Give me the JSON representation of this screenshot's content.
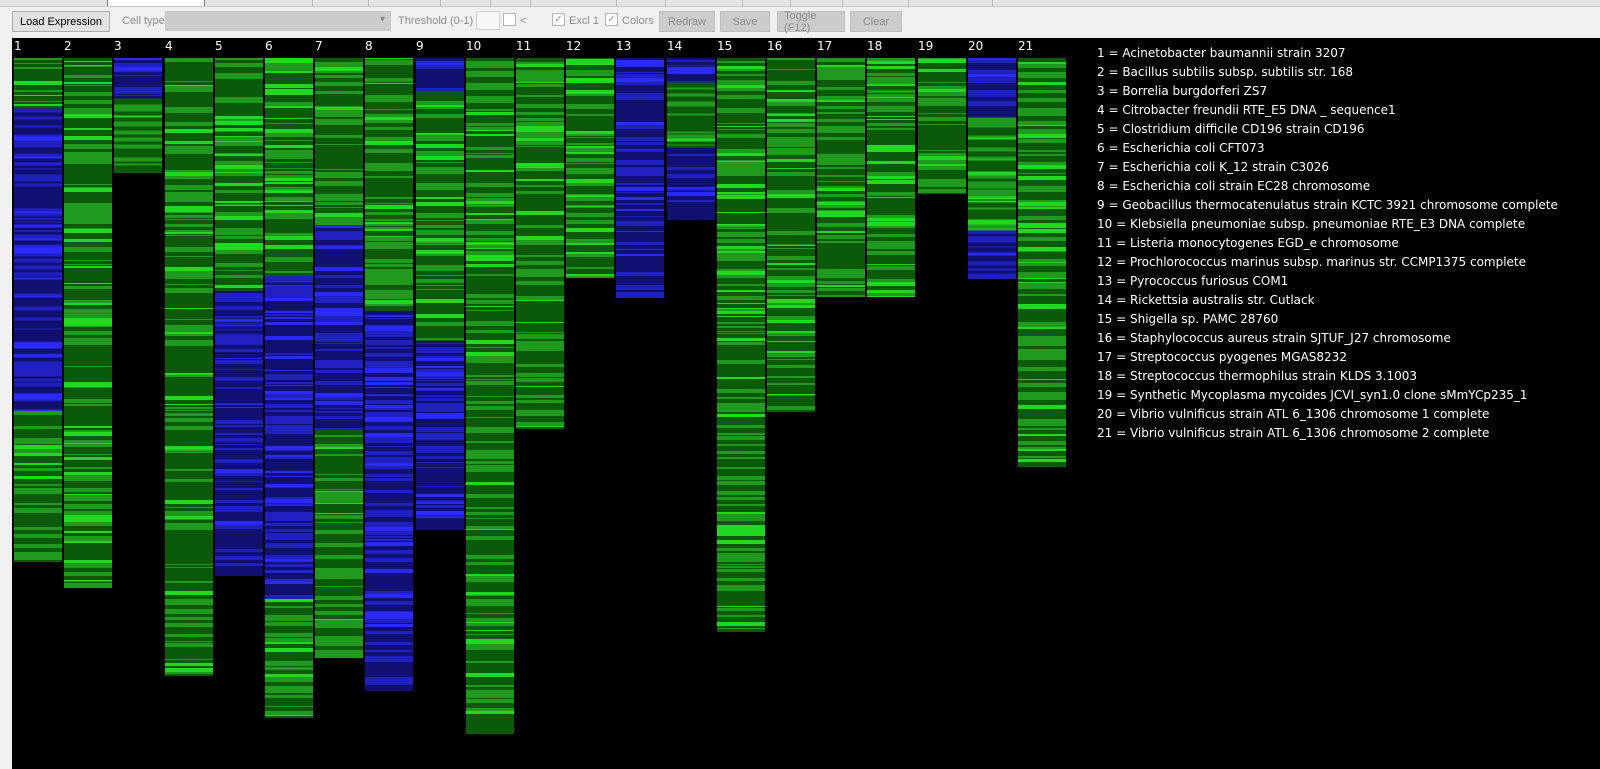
{
  "toolbar": {
    "load_label": "Load Expression",
    "celltype_label": "Cell type",
    "celltype_value": "",
    "threshold_label": "Threshold (0-1)",
    "threshold_value": "",
    "less_than": "<",
    "excl_label": "Excl 1",
    "colors_label": "Colors",
    "check_mark": "✓",
    "chevron": "▾",
    "redraw_label": "Redraw",
    "save_label": "Save",
    "toggle_label": "Toggle (F12)",
    "clear_label": "Clear"
  },
  "colors": {
    "background": "#000000",
    "green_dark": "#0a5a0a",
    "green_mid": "#1f9a1f",
    "green_bright": "#20d820",
    "blue_dark": "#101070",
    "blue_mid": "#2020c0",
    "blue_bright": "#2a2aff"
  },
  "chart_data": {
    "type": "heatmap",
    "columns": [
      {
        "id": "1",
        "name": "Acinetobacter baumannii strain 3207",
        "length": 0.708,
        "segments": [
          [
            "green",
            0.1
          ],
          [
            "blue",
            0.7
          ],
          [
            "green",
            1
          ]
        ]
      },
      {
        "id": "2",
        "name": "Bacillus subtilis subsp. subtilis str. 168",
        "length": 0.745,
        "segments": [
          [
            "green",
            1
          ]
        ]
      },
      {
        "id": "3",
        "name": "Borrelia burgdorferi ZS7",
        "length": 0.161,
        "segments": [
          [
            "blue",
            0.35
          ],
          [
            "green",
            1
          ]
        ]
      },
      {
        "id": "4",
        "name": "Citrobacter freundii RTE_E5 DNA  _ sequence1",
        "length": 0.868,
        "segments": [
          [
            "green",
            1
          ]
        ]
      },
      {
        "id": "5",
        "name": "Clostridium difficile CD196   strain CD196",
        "length": 0.728,
        "segments": [
          [
            "green",
            0.45
          ],
          [
            "blue",
            1
          ]
        ]
      },
      {
        "id": "6",
        "name": "Escherichia coli CFT073",
        "length": 0.927,
        "segments": [
          [
            "green",
            0.33
          ],
          [
            "blue",
            0.82
          ],
          [
            "green",
            1
          ]
        ]
      },
      {
        "id": "7",
        "name": "Escherichia coli K_12 strain C3026",
        "length": 0.843,
        "segments": [
          [
            "green",
            0.28
          ],
          [
            "blue",
            0.62
          ],
          [
            "green",
            1
          ]
        ]
      },
      {
        "id": "8",
        "name": "Escherichia coli strain EC28 chromosome",
        "length": 0.889,
        "segments": [
          [
            "green",
            0.4
          ],
          [
            "blue",
            1
          ]
        ]
      },
      {
        "id": "9",
        "name": "Geobacillus thermocatenulatus strain KCTC 3921 chromosome  complete",
        "length": 0.663,
        "segments": [
          [
            "blue",
            0.07
          ],
          [
            "green",
            0.6
          ],
          [
            "blue",
            1
          ]
        ]
      },
      {
        "id": "10",
        "name": "Klebsiella pneumoniae subsp. pneumoniae RTE_E3 DNA  complete",
        "length": 0.95,
        "segments": [
          [
            "green",
            1
          ]
        ]
      },
      {
        "id": "11",
        "name": "Listeria monocytogenes EGD_e chromosome",
        "length": 0.521,
        "segments": [
          [
            "green",
            1
          ]
        ]
      },
      {
        "id": "12",
        "name": "Prochlorococcus marinus subsp. marinus str. CCMP1375  complete",
        "length": 0.309,
        "segments": [
          [
            "green",
            1
          ]
        ]
      },
      {
        "id": "13",
        "name": "Pyrococcus furiosus COM1",
        "length": 0.337,
        "segments": [
          [
            "blue",
            1
          ]
        ]
      },
      {
        "id": "14",
        "name": "Rickettsia australis str. Cutlack",
        "length": 0.228,
        "segments": [
          [
            "blue",
            0.15
          ],
          [
            "green",
            0.55
          ],
          [
            "blue",
            1
          ]
        ]
      },
      {
        "id": "15",
        "name": "Shigella sp. PAMC 28760",
        "length": 0.806,
        "segments": [
          [
            "green",
            1
          ]
        ]
      },
      {
        "id": "16",
        "name": "Staphylococcus aureus strain SJTUF_J27 chromosome",
        "length": 0.497,
        "segments": [
          [
            "green",
            1
          ]
        ]
      },
      {
        "id": "17",
        "name": "Streptococcus pyogenes MGAS8232",
        "length": 0.335,
        "segments": [
          [
            "green",
            1
          ]
        ]
      },
      {
        "id": "18",
        "name": "Streptococcus thermophilus strain KLDS 3.1003",
        "length": 0.335,
        "segments": [
          [
            "green",
            1
          ]
        ]
      },
      {
        "id": "19",
        "name": "Synthetic Mycoplasma mycoides JCVI_syn1.0 clone sMmYCp235_1",
        "length": 0.191,
        "segments": [
          [
            "green",
            1
          ]
        ]
      },
      {
        "id": "20",
        "name": "Vibrio vulnificus strain ATL 6_1306 chromosome 1  complete",
        "length": 0.31,
        "segments": [
          [
            "blue",
            0.27
          ],
          [
            "green",
            0.78
          ],
          [
            "blue",
            1
          ]
        ]
      },
      {
        "id": "21",
        "name": "Vibrio vulnificus strain ATL 6_1306 chromosome 2  complete",
        "length": 0.574,
        "segments": [
          [
            "green",
            1
          ]
        ]
      }
    ]
  }
}
